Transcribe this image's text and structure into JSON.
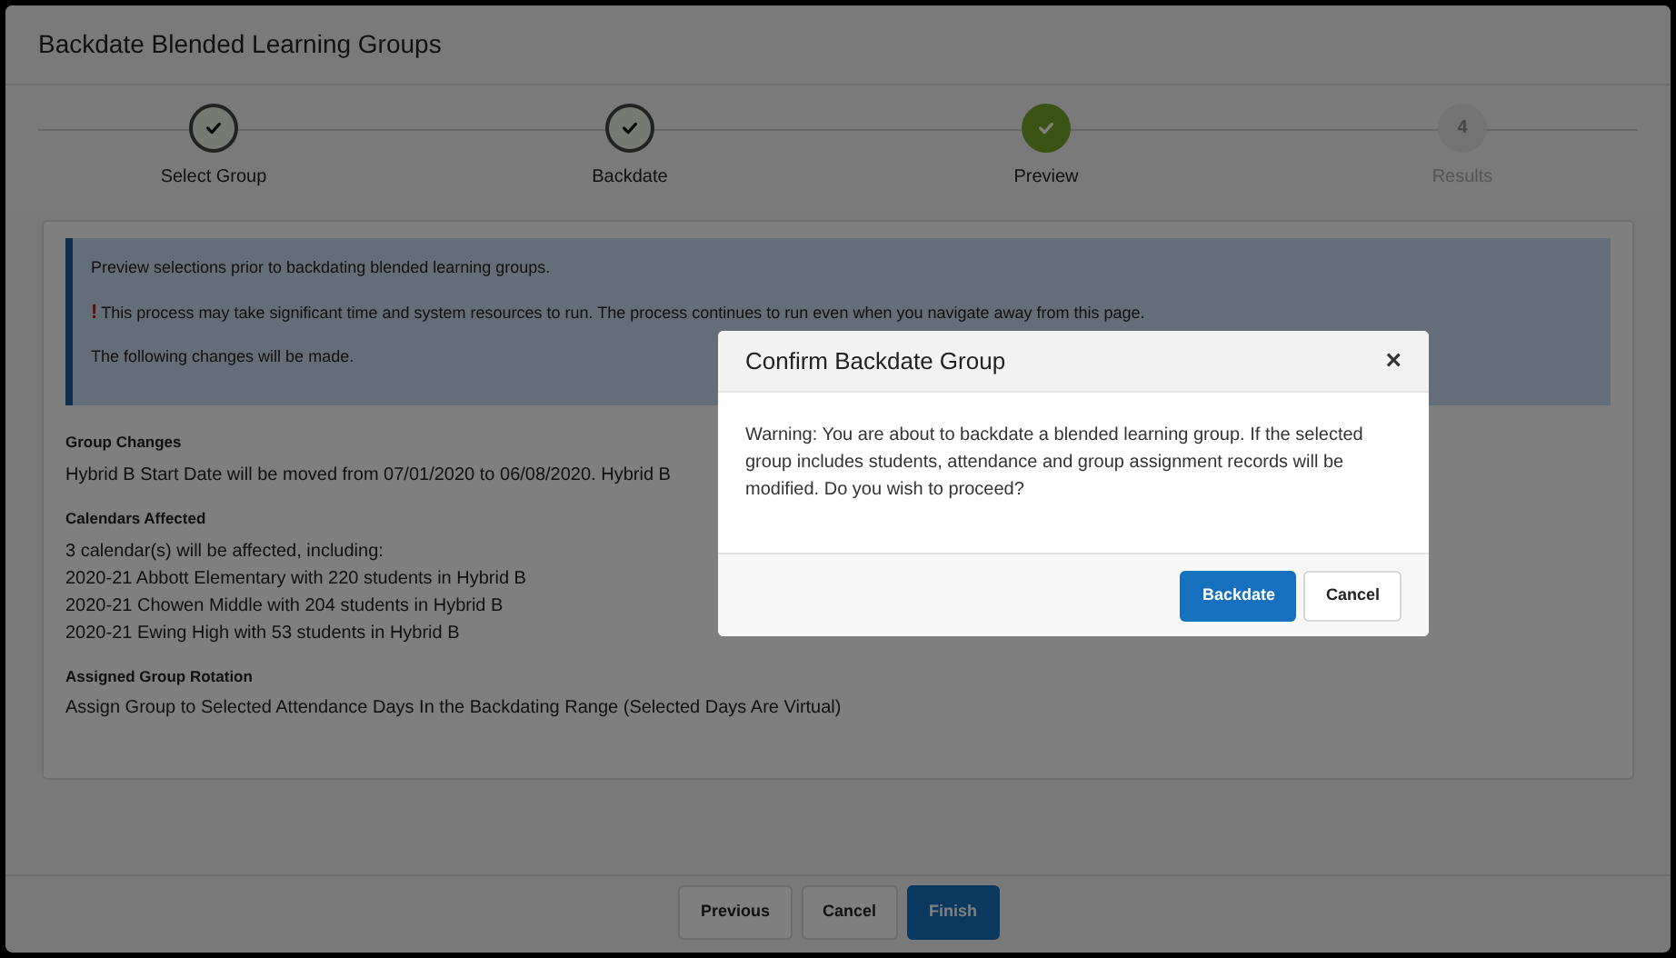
{
  "window": {
    "title": "Backdate Blended Learning Groups"
  },
  "steps": [
    {
      "label": "Select Group",
      "completed": true,
      "selected": false
    },
    {
      "label": "Backdate",
      "completed": true,
      "selected": false
    },
    {
      "label": "Preview",
      "completed": true,
      "selected": true
    },
    {
      "label": "Results",
      "completed": false,
      "selected": false,
      "number": "4"
    }
  ],
  "info": {
    "intro": "Preview selections prior to backdating blended learning groups.",
    "warning_mark": "!",
    "warning": "This process may take significant time and system resources to run. The process continues to run even when you navigate away from this page.",
    "changes": "The following changes will be made."
  },
  "sections": [
    {
      "heading": "Group Changes",
      "lines": [
        "Hybrid B Start Date will be moved from 07/01/2020 to 06/08/2020. Hybrid B"
      ]
    },
    {
      "heading": "Calendars Affected",
      "lines": [
        "3 calendar(s) will be affected, including:",
        "2020-21 Abbott Elementary with 220 students in Hybrid B",
        "2020-21 Chowen Middle with 204 students in Hybrid B",
        "2020-21 Ewing High with 53 students in Hybrid B"
      ]
    },
    {
      "heading": "Assigned Group Rotation",
      "lines": [
        "Assign Group to Selected Attendance Days In the Backdating Range (Selected Days Are Virtual)"
      ]
    }
  ],
  "footer_buttons": [
    {
      "label": "Previous",
      "kind": "secondary"
    },
    {
      "label": "Cancel",
      "kind": "secondary"
    },
    {
      "label": "Finish",
      "kind": "primary"
    }
  ],
  "dialog": {
    "title": "Confirm Backdate Group",
    "close": "×",
    "message": "Warning: You are about to backdate a blended learning group. If the selected group includes students, attendance and group assignment records will be modified. Do you wish to proceed?",
    "buttons": [
      {
        "label": "Backdate",
        "kind": "primary"
      },
      {
        "label": "Cancel",
        "kind": "secondary"
      }
    ]
  }
}
